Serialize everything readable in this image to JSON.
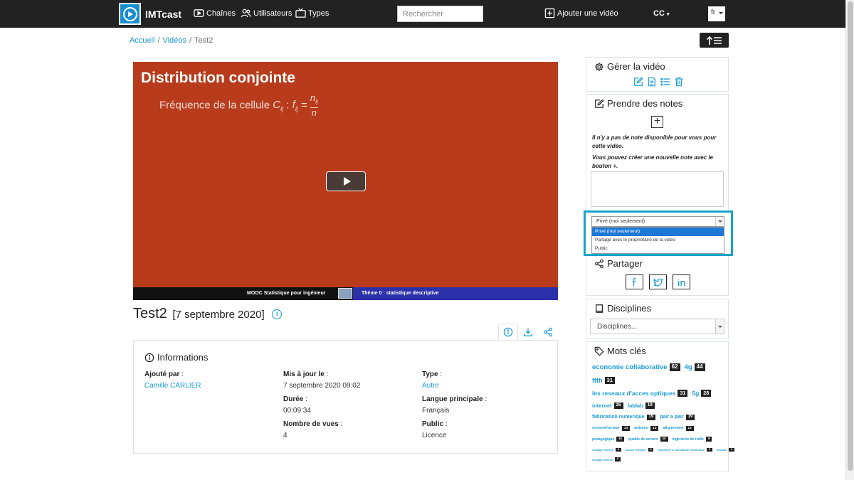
{
  "nav": {
    "brand": "IMTcast",
    "links": [
      "Chaînes",
      "Utilisateurs",
      "Types"
    ],
    "search_placeholder": "Rechercher",
    "add_video": "Ajouter une vidéo",
    "cc": "CC",
    "lang": "fr"
  },
  "breadcrumb": [
    "Accueil",
    "Vidéos",
    "Test2"
  ],
  "video": {
    "slide_title": "Distribution conjointe",
    "slide_subtitle": "Fréquence de la cellule",
    "slide_formula": "Cij : fij = nij / n",
    "bar_left": "MOOC Statistique pour ingénieur",
    "bar_right": "Thème 0 : statistique descriptive",
    "title": "Test2",
    "date": "[7 septembre 2020]"
  },
  "info": {
    "heading": "Informations",
    "fields": [
      {
        "label": "Ajouté par",
        "value": "Camille CARLIER"
      },
      {
        "label": "Mis à jour le",
        "value": "7 septembre 2020 09:02"
      },
      {
        "label": "Type",
        "value": "Autre"
      },
      {
        "label": "Durée",
        "value": "00:09:34"
      },
      {
        "label": "Langue principale",
        "value": "Français"
      },
      {
        "label": "Nombre de vues",
        "value": "4"
      },
      {
        "label": "Public",
        "value": "Licence"
      }
    ]
  },
  "sidebar": {
    "manage_title": "Gérer la vidéo",
    "notes_title": "Prendre des notes",
    "notes_msg1": "Il n'y a pas de note disponible pour vous pour cette vidéo.",
    "notes_msg2": "Vous pouvez créer une nouvelle note avec le bouton +.",
    "visibility_selected": "Privé (moi seulement)",
    "visibility_options": [
      "Privé (moi seulement)",
      "Partagé avec le propriétaire de la vidéo",
      "Public"
    ],
    "share_title": "Partager",
    "disciplines_title": "Disciplines",
    "disciplines_placeholder": "Disciplines...",
    "keywords_title": "Mots clés",
    "tags": [
      {
        "name": "economie collaborative",
        "count": "62"
      },
      {
        "name": "4g",
        "count": "44"
      },
      {
        "name": "ftth",
        "count": "31"
      },
      {
        "name": "les reseaux d'acces optiques",
        "count": "31"
      },
      {
        "name": "5g",
        "count": "28"
      },
      {
        "name": "internet",
        "count": "25"
      },
      {
        "name": "fablab",
        "count": "19"
      },
      {
        "name": "fabrication numerique",
        "count": "19"
      },
      {
        "name": "pair a pair",
        "count": "19"
      },
      {
        "name": "consom'acteur",
        "count": "14"
      },
      {
        "name": "arduino",
        "count": "13"
      },
      {
        "name": "alignement",
        "count": "12"
      },
      {
        "name": "pedagogique",
        "count": "10"
      },
      {
        "name": "qualite de service",
        "count": "10"
      },
      {
        "name": "ingenierie de trafic",
        "count": "9"
      },
      {
        "name": "routage externe",
        "count": "8"
      },
      {
        "name": "classe virtuelle",
        "count": "8"
      },
      {
        "name": "machines a commande numerique",
        "count": "8"
      },
      {
        "name": "moodle",
        "count": "8"
      },
      {
        "name": "routage interne",
        "count": "8"
      }
    ]
  }
}
